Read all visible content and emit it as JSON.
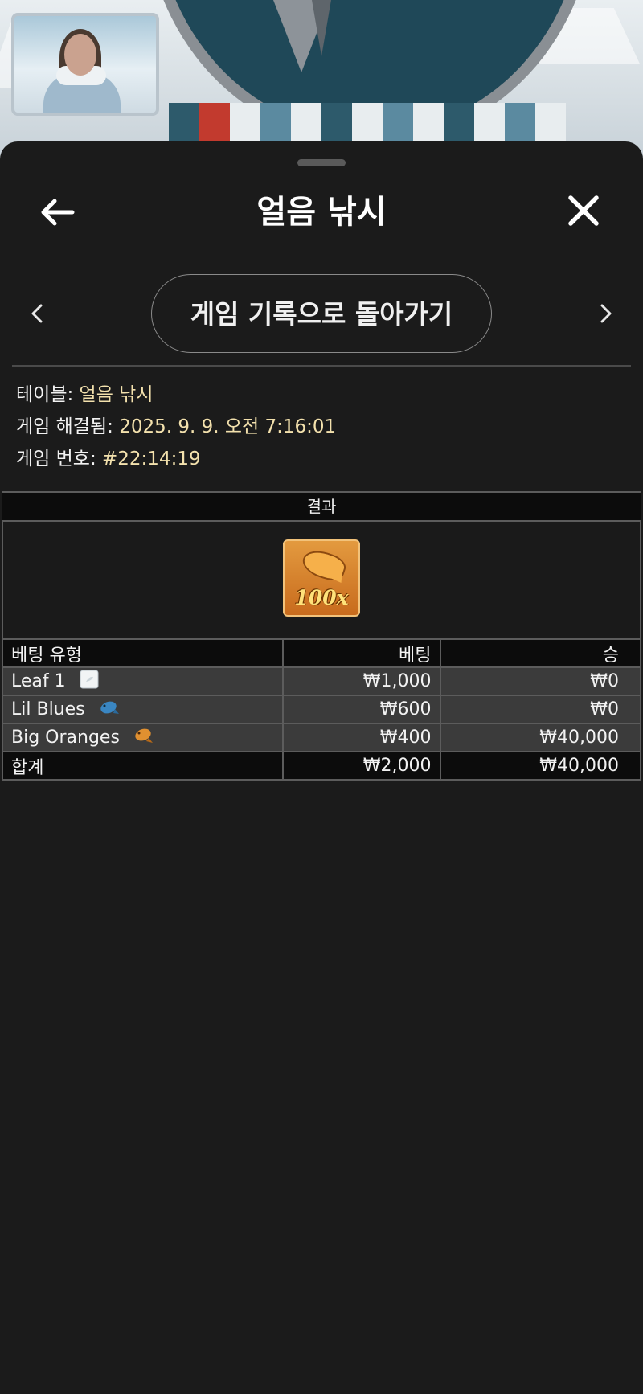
{
  "header": {
    "title": "얼음 낚시"
  },
  "nav": {
    "history_label": "게임 기록으로 돌아가기"
  },
  "info": {
    "table_label": "테이블:",
    "table_value": "얼음 낚시",
    "resolved_label": "게임 해결됨:",
    "resolved_value": "2025. 9. 9. 오전 7:16:01",
    "game_no_label": "게임 번호:",
    "game_no_value": "#22:14:19"
  },
  "result": {
    "header": "결과",
    "multiplier": "100x",
    "icon": "orange-fish-icon"
  },
  "bets_table": {
    "headers": {
      "type": "베팅 유형",
      "bet": "베팅",
      "win": "승"
    },
    "rows": [
      {
        "type": "Leaf 1",
        "bet": "₩1,000",
        "win": "₩0",
        "icon": "leaf-tile-icon"
      },
      {
        "type": "Lil Blues",
        "bet": "₩600",
        "win": "₩0",
        "icon": "blue-fish-icon"
      },
      {
        "type": "Big Oranges",
        "bet": "₩400",
        "win": "₩40,000",
        "icon": "orange-fish-icon"
      }
    ],
    "total": {
      "label": "합계",
      "bet": "₩2,000",
      "win": "₩40,000"
    }
  },
  "colors": {
    "panel": "#1b1b1b",
    "value_text": "#f3e1ad",
    "row_bg": "#3b3b3b",
    "header_bg": "#0c0c0c"
  }
}
